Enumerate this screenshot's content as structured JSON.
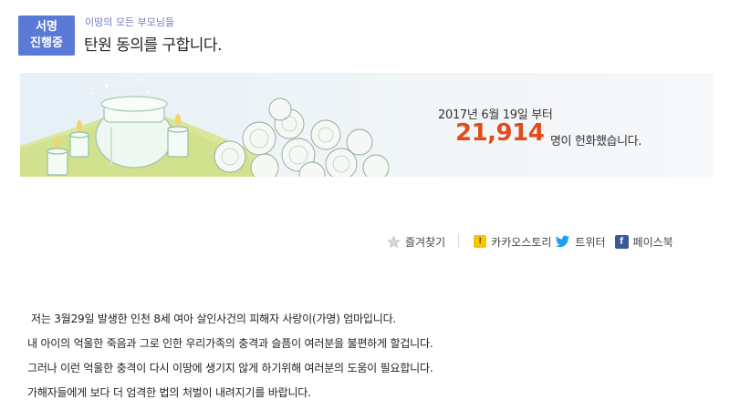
{
  "header": {
    "badge_line1": "서명",
    "badge_line2": "진행중",
    "subtitle": "이땅의 모든 부모님들",
    "title": "탄원 동의를 구합니다."
  },
  "banner": {
    "period": "2017년 6월 19일 부터",
    "count": "21,914",
    "count_suffix": "명이 헌화했습니다.",
    "accent_color": "#e04c1c"
  },
  "share": {
    "bookmark_label": "즐겨찾기",
    "kakao_label": "카카오스토리",
    "twitter_label": "트위터",
    "facebook_label": "페이스북",
    "icons": [
      "star-icon",
      "kakaostory-icon",
      "twitter-icon",
      "facebook-icon"
    ]
  },
  "content": {
    "paragraphs": [
      "저는 3월29일 발생한 인천 8세 여아 살인사건의 피해자 사랑이(가명) 엄마입니다.",
      "내 아이의 억울한 죽음과 그로 인한 우리가족의 충격과 슬픔이 여러분을 불편하게 할겁니다.",
      "그러나 이런 억울한 충격이 다시 이땅에 생기지 않게 하기위해 여러분의 도움이 필요합니다.",
      "가해자들에게 보다 더 엄격한 법의 처벌이 내려지기를 바랍니다."
    ]
  },
  "colors": {
    "badge": "#5b7ad6",
    "subtitle": "#6d7fc7",
    "kakao": "#f7c600",
    "facebook": "#3b5998",
    "twitter": "#1da1f2"
  }
}
